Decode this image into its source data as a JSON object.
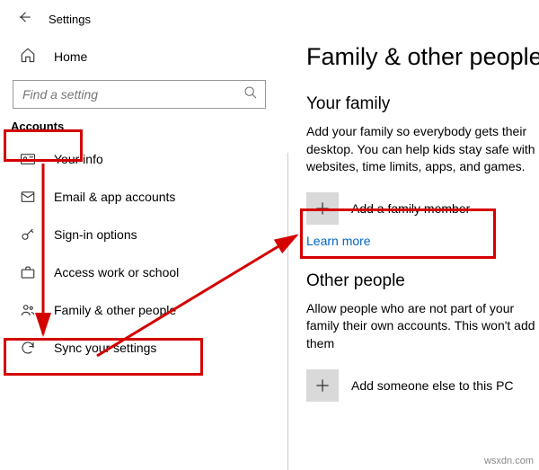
{
  "header": {
    "title": "Settings"
  },
  "sidebar": {
    "home": "Home",
    "search_placeholder": "Find a setting",
    "section": "Accounts",
    "items": [
      {
        "label": "Your info"
      },
      {
        "label": "Email & app accounts"
      },
      {
        "label": "Sign-in options"
      },
      {
        "label": "Access work or school"
      },
      {
        "label": "Family & other people"
      },
      {
        "label": "Sync your settings"
      }
    ]
  },
  "main": {
    "title": "Family & other people",
    "family_heading": "Your family",
    "family_text": "Add your family so everybody gets their desktop. You can help kids stay safe with websites, time limits, apps, and games.",
    "add_family": "Add a family member",
    "learn_more": "Learn more",
    "other_heading": "Other people",
    "other_text": "Allow people who are not part of your family their own accounts. This won't add them",
    "add_other": "Add someone else to this PC"
  },
  "watermark": "wsxdn.com"
}
